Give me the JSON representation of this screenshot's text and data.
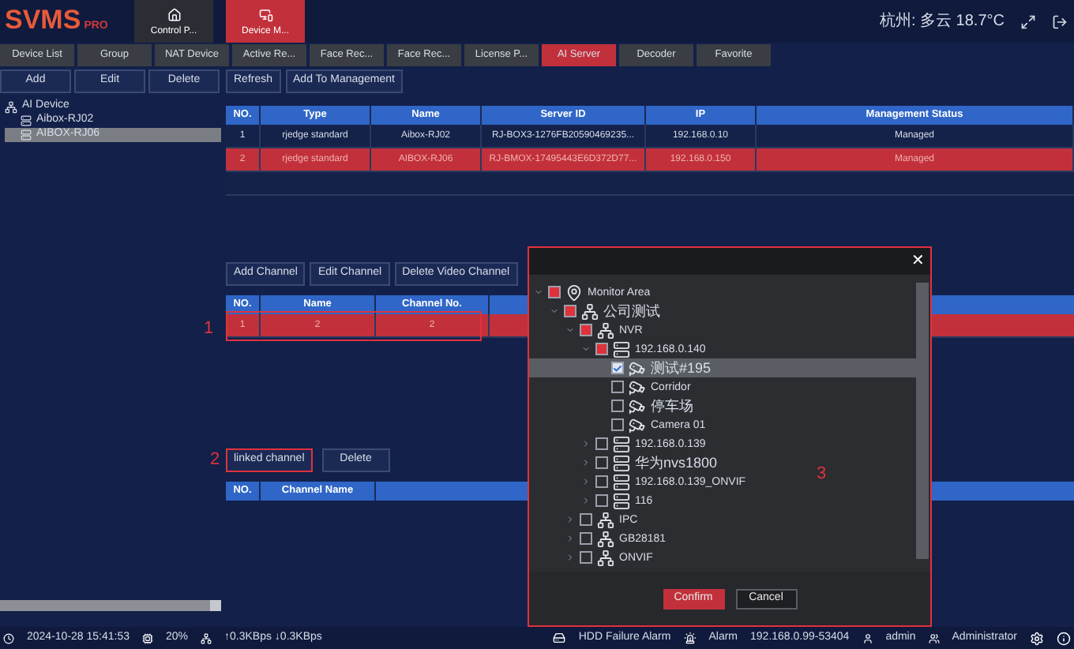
{
  "header": {
    "logo": "SVMS",
    "logo_suffix": "PRO",
    "tabs": [
      {
        "label": "Control P...",
        "selected": false
      },
      {
        "label": "Device M...",
        "selected": true
      }
    ],
    "weather": "杭州: 多云 18.7°C"
  },
  "sub_tabs": [
    {
      "label": "Device List",
      "selected": false
    },
    {
      "label": "Group",
      "selected": false
    },
    {
      "label": "NAT Device",
      "selected": false
    },
    {
      "label": "Active Re...",
      "selected": false
    },
    {
      "label": "Face Rec...",
      "selected": false
    },
    {
      "label": "Face Rec...",
      "selected": false
    },
    {
      "label": "License P...",
      "selected": false
    },
    {
      "label": "AI Server",
      "selected": true
    },
    {
      "label": "Decoder",
      "selected": false
    },
    {
      "label": "Favorite",
      "selected": false
    }
  ],
  "left_buttons": [
    "Add",
    "Edit",
    "Delete"
  ],
  "device_tree": {
    "label": "AI Device",
    "children": [
      {
        "label": "Aibox-RJ02",
        "selected": false
      },
      {
        "label": "AIBOX-RJ06",
        "selected": true
      }
    ]
  },
  "server_buttons": [
    "Refresh",
    "Add To Management"
  ],
  "server_table": {
    "columns": [
      "NO.",
      "Type",
      "Name",
      "Server ID",
      "IP",
      "Management Status"
    ],
    "rows": [
      {
        "cells": [
          "1",
          "rjedge standard",
          "Aibox-RJ02",
          "RJ-BOX3-1276FB20590469235...",
          "192.168.0.10",
          "Managed"
        ],
        "selected": false
      },
      {
        "cells": [
          "2",
          "rjedge standard",
          "AIBOX-RJ06",
          "RJ-BMOX-17495443E6D372D77...",
          "192.168.0.150",
          "Managed"
        ],
        "selected": true
      }
    ]
  },
  "channel_buttons": [
    "Add Channel",
    "Edit Channel",
    "Delete Video Channel"
  ],
  "channel_table": {
    "columns": [
      "NO.",
      "Name",
      "Channel No."
    ],
    "rows": [
      {
        "cells": [
          "1",
          "2",
          "2"
        ],
        "selected": true,
        "annotation": "1"
      }
    ]
  },
  "linked_buttons": [
    {
      "label": "linked channel",
      "annotation": "2"
    },
    {
      "label": "Delete"
    }
  ],
  "linked_table": {
    "columns": [
      "NO.",
      "Channel Name"
    ]
  },
  "dialog": {
    "annotation": "3",
    "close": "✕",
    "tree": [
      {
        "label": "Monitor Area",
        "kind": "area",
        "checked": false,
        "partial": true,
        "expanded": true,
        "children": [
          {
            "label": "公司测试",
            "kind": "group",
            "checked": false,
            "partial": true,
            "expanded": true,
            "children": [
              {
                "label": "NVR",
                "kind": "group",
                "checked": false,
                "partial": true,
                "expanded": true,
                "children": [
                  {
                    "label": "192.168.0.140",
                    "kind": "nvr",
                    "checked": false,
                    "partial": true,
                    "expanded": true,
                    "children": [
                      {
                        "label": "测试#195",
                        "kind": "camera",
                        "checked": true,
                        "partial": false,
                        "selected": true
                      },
                      {
                        "label": "Corridor",
                        "kind": "camera",
                        "checked": false,
                        "partial": false,
                        "selected": false
                      },
                      {
                        "label": "停车场",
                        "kind": "camera",
                        "checked": false,
                        "partial": false,
                        "selected": false
                      },
                      {
                        "label": "Camera 01",
                        "kind": "camera",
                        "checked": false,
                        "partial": false,
                        "selected": false
                      }
                    ]
                  },
                  {
                    "label": "192.168.0.139",
                    "kind": "nvr",
                    "checked": false,
                    "partial": false,
                    "expanded": false
                  },
                  {
                    "label": "华为nvs1800",
                    "kind": "nvr",
                    "checked": false,
                    "partial": false,
                    "expanded": false
                  },
                  {
                    "label": "192.168.0.139_ONVIF",
                    "kind": "nvr",
                    "checked": false,
                    "partial": false,
                    "expanded": false
                  },
                  {
                    "label": "116",
                    "kind": "nvr",
                    "checked": false,
                    "partial": false,
                    "expanded": false
                  }
                ]
              },
              {
                "label": "IPC",
                "kind": "group",
                "checked": false,
                "partial": false,
                "expanded": false
              },
              {
                "label": "GB28181",
                "kind": "group",
                "checked": false,
                "partial": false,
                "expanded": false
              },
              {
                "label": "ONVIF",
                "kind": "group",
                "checked": false,
                "partial": false,
                "expanded": false
              }
            ]
          }
        ]
      }
    ],
    "buttons": [
      {
        "label": "Confirm",
        "kind": "primary"
      },
      {
        "label": "Cancel",
        "kind": "secondary"
      }
    ]
  },
  "status_bar": {
    "datetime": "2024-10-28 15:41:53",
    "cpu": "20%",
    "network": "↑0.3KBps ↓0.3KBps",
    "hdd_alarm": "HDD Failure Alarm",
    "alarm": "Alarm",
    "address": "192.168.0.99-53404",
    "user": "admin",
    "role": "Administrator"
  }
}
